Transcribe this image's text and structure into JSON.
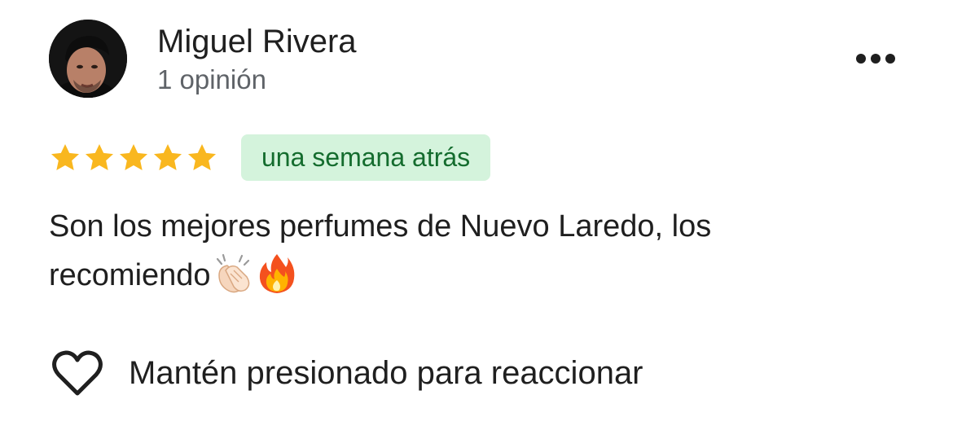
{
  "review": {
    "author": {
      "name": "Miguel Rivera",
      "review_count": "1 opinión",
      "avatar_icon": "user-photo"
    },
    "more_icon": "more-horizontal-icon",
    "rating": {
      "stars": 5,
      "max": 5,
      "star_color": "#f9b71f"
    },
    "time_ago": "una semana atrás",
    "text": {
      "line1": "Son los mejores perfumes de Nuevo Laredo, los",
      "line2": "recomiendo"
    },
    "emojis": [
      "clapping-hands-icon",
      "fire-icon"
    ],
    "react": {
      "icon": "heart-outline-icon",
      "label": "Mantén presionado para reaccionar"
    },
    "colors": {
      "badge_bg": "#d4f3dc",
      "badge_text": "#146c2e",
      "secondary_text": "#5f6368"
    }
  }
}
